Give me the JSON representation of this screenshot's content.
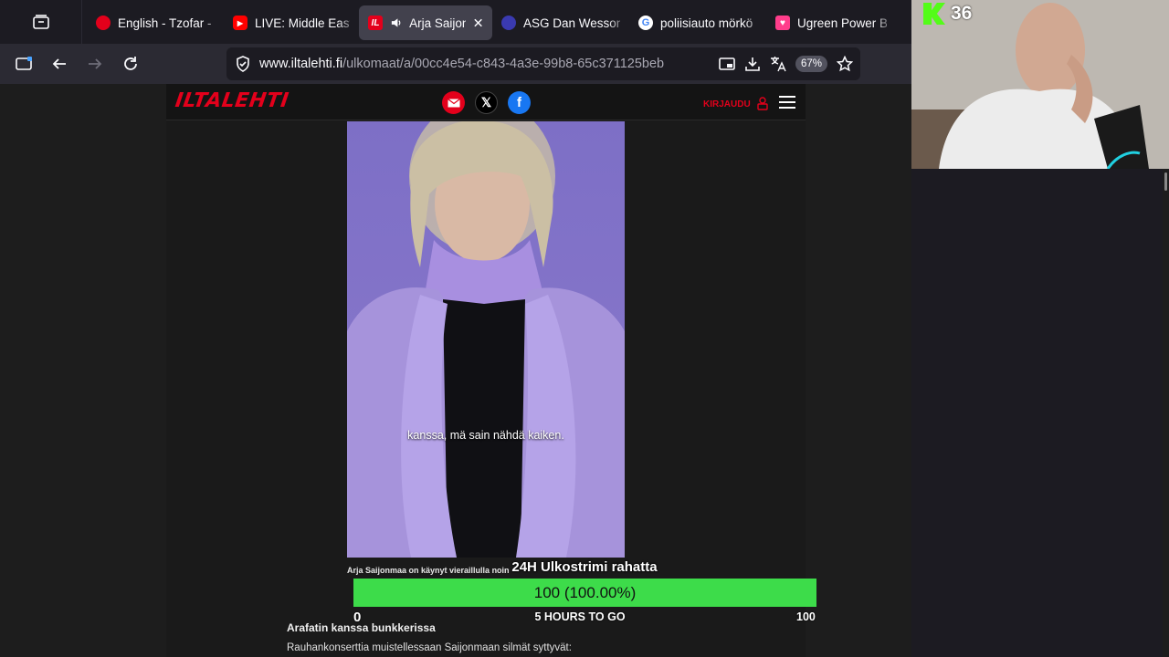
{
  "browser": {
    "tabs": [
      {
        "label": "English - Tzofar - I",
        "favicon_color": "#e3001b",
        "favicon_glyph": "●"
      },
      {
        "label": "LIVE: Middle East",
        "favicon_color": "#ff0000",
        "favicon_glyph": "▶"
      },
      {
        "label": "Arja Saijonm",
        "favicon_color": "#e3001b",
        "favicon_glyph": "IL",
        "active": true
      },
      {
        "label": "ASG Dan Wesson",
        "favicon_color": "#3a3ab0",
        "favicon_glyph": "◉"
      },
      {
        "label": "poliisiauto mörkö",
        "favicon_color": "#ffffff",
        "favicon_glyph": "G"
      },
      {
        "label": "Ugreen Power Bar",
        "favicon_color": "#ff3d8b",
        "favicon_glyph": "♥"
      }
    ],
    "url": {
      "domain": "www.iltalehti.fi",
      "path": "/ulkomaat/a/00cc4e54-c843-4a3e-99b8-65c371125beb"
    },
    "zoom": "67%"
  },
  "site": {
    "logo": "ILTALEHTI",
    "login_label": "KIRJAUDU",
    "brand_color": "#e3001b"
  },
  "video": {
    "subtitle": "kanssa, mä sain nähdä kaiken."
  },
  "article": {
    "caption": "Arja Saijonmaa on käynyt vieraillulla noin",
    "section_heading": "Arafatin kanssa bunkkerissa",
    "body_start": "Rauhankonserttia muistellessaan Saijonmaan silmät syttyvät:"
  },
  "goal": {
    "title": "24H Ulkostrimi rahatta",
    "value_text": "100 (100.00%)",
    "fraction": 1.0,
    "min": "0",
    "max": "100",
    "remaining": "5 HOURS TO GO",
    "color": "#3ddc4a"
  },
  "stream": {
    "viewer_count": "36",
    "kick_color": "#53fc18"
  }
}
